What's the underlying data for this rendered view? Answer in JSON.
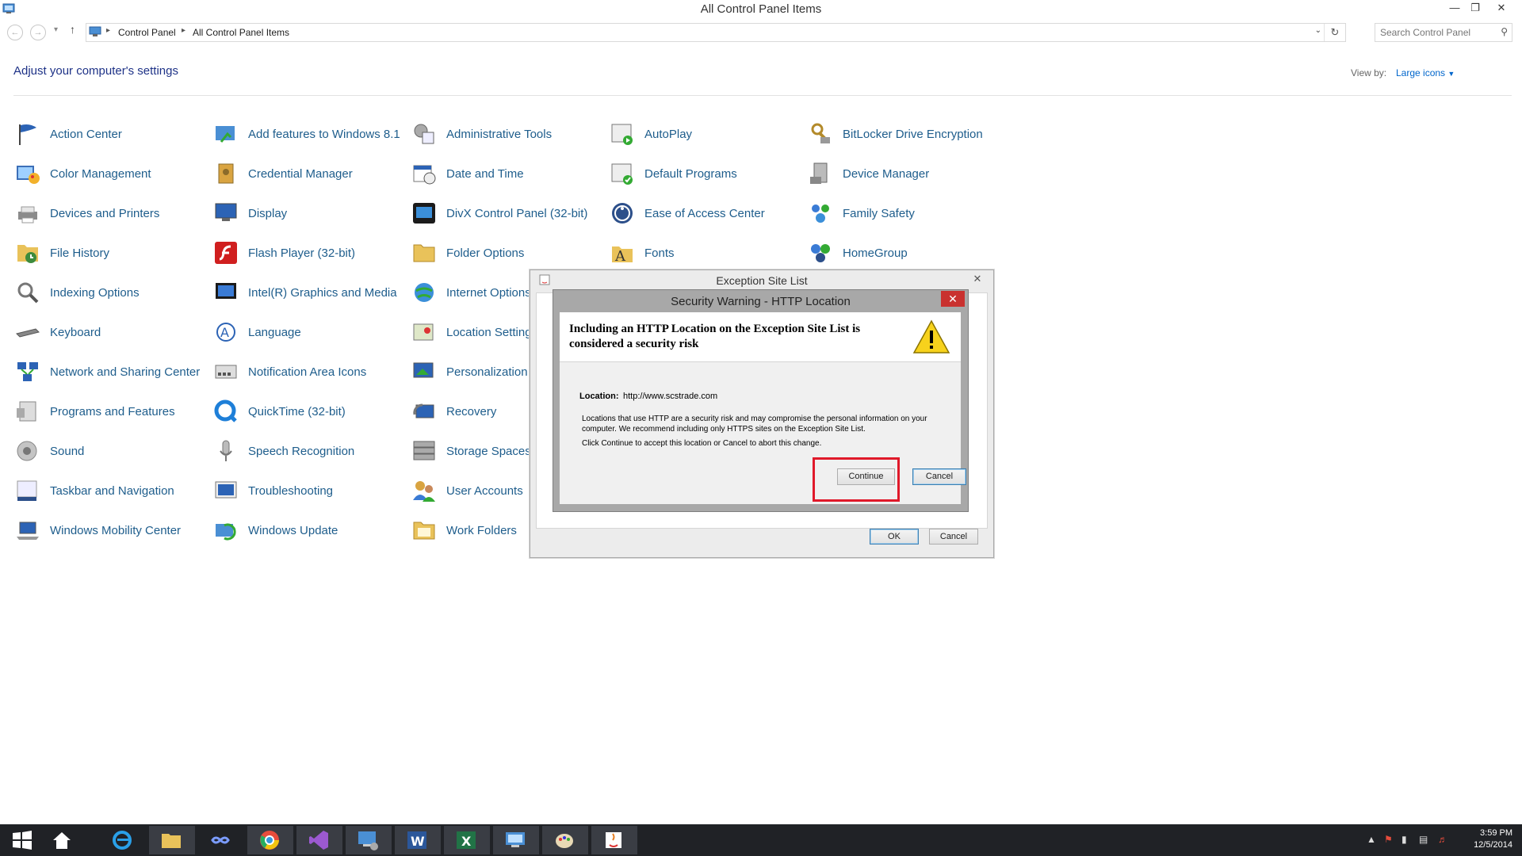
{
  "window": {
    "title": "All Control Panel Items"
  },
  "address": {
    "crumbs": [
      "Control Panel",
      "All Control Panel Items"
    ],
    "search_placeholder": "Search Control Panel"
  },
  "header": {
    "heading": "Adjust your computer's settings",
    "view_by_label": "View by:",
    "view_by_value": "Large icons"
  },
  "items": [
    [
      "Action Center",
      "Color Management",
      "Devices and Printers",
      "File History",
      "Indexing Options",
      "Keyboard",
      "Network and Sharing Center",
      "Programs and Features",
      "Sound",
      "Taskbar and Navigation",
      "Windows Mobility Center"
    ],
    [
      "Add features to Windows 8.1",
      "Credential Manager",
      "Display",
      "Flash Player (32-bit)",
      "Intel(R) Graphics and Media",
      "Language",
      "Notification Area Icons",
      "QuickTime (32-bit)",
      "Speech Recognition",
      "Troubleshooting",
      "Windows Update"
    ],
    [
      "Administrative Tools",
      "Date and Time",
      "DivX Control Panel (32-bit)",
      "Folder Options",
      "Internet Options",
      "Location Settings",
      "Personalization",
      "Recovery",
      "Storage Spaces",
      "User Accounts",
      "Work Folders"
    ],
    [
      "AutoPlay",
      "Default Programs",
      "Ease of Access Center",
      "Fonts"
    ],
    [
      "BitLocker Drive Encryption",
      "Device Manager",
      "Family Safety",
      "HomeGroup"
    ]
  ],
  "exception_dialog": {
    "title": "Exception Site List",
    "ok": "OK",
    "cancel": "Cancel"
  },
  "security_dialog": {
    "title": "Security Warning - HTTP Location",
    "headline": "Including an HTTP Location on the Exception Site List is considered a security risk",
    "location_label": "Location:",
    "location_value": "http://www.scstrade.com",
    "description": "Locations that use HTTP are a security risk and may compromise the personal information on your computer.  We recommend including only HTTPS sites on the Exception Site List.",
    "instruction": "Click Continue to accept this location or Cancel to abort this change.",
    "continue": "Continue",
    "cancel": "Cancel"
  },
  "taskbar": {
    "apps": [
      "start",
      "home",
      "internet-explorer",
      "file-explorer",
      "infinity",
      "chrome",
      "visual-studio",
      "remote-desktop",
      "word",
      "excel",
      "control-panel",
      "paint",
      "java"
    ],
    "time": "3:59 PM",
    "date": "12/5/2014"
  },
  "colors": {
    "link": "#1e5d8c",
    "heading": "#1e3287",
    "highlight": "#e0192a",
    "taskbar": "#202226"
  }
}
